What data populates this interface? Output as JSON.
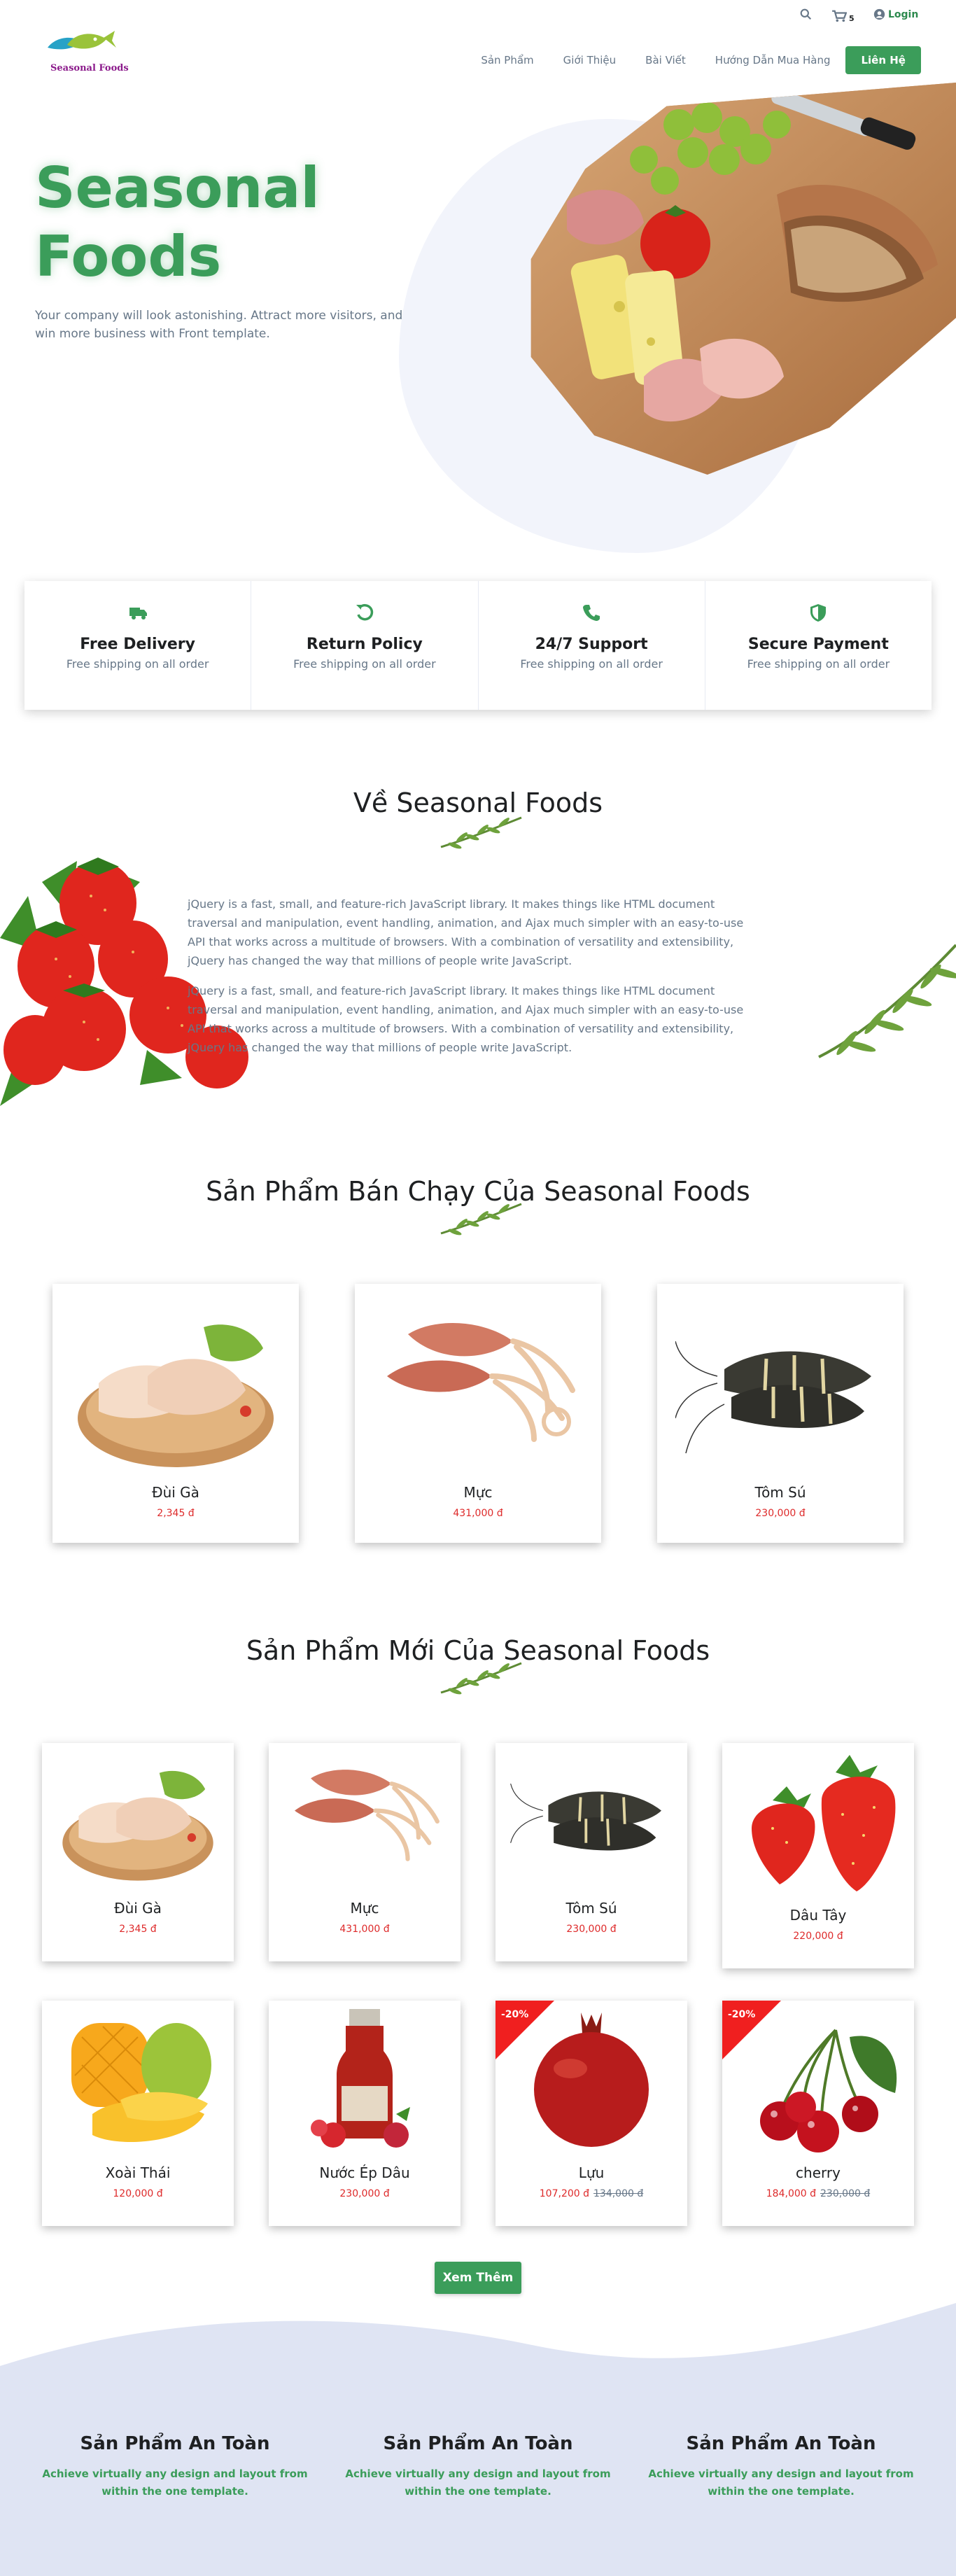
{
  "brand": {
    "name": "Seasonal Foods",
    "accent": "#3b9d5a",
    "logo_color": "#8b1a8b"
  },
  "utility": {
    "search_icon": "search-icon",
    "cart_icon": "cart-icon",
    "cart_count": "5",
    "login_label": "Login"
  },
  "nav": {
    "items": [
      {
        "label": "Sản Phẩm"
      },
      {
        "label": "Giới Thiệu"
      },
      {
        "label": "Bài Viết"
      },
      {
        "label": "Hướng Dẫn Mua Hàng"
      }
    ],
    "contact_label": "Liên Hệ"
  },
  "hero": {
    "title_line1": "Seasonal",
    "title_line2": "Foods",
    "subtitle": "Your company will look astonishing. Attract more visitors, and win more business with Front template."
  },
  "features": [
    {
      "icon": "truck-icon",
      "title": "Free Delivery",
      "desc": "Free shipping on all order"
    },
    {
      "icon": "return-icon",
      "title": "Return Policy",
      "desc": "Free shipping on all order"
    },
    {
      "icon": "phone-icon",
      "title": "24/7 Support",
      "desc": "Free shipping on all order"
    },
    {
      "icon": "shield-icon",
      "title": "Secure Payment",
      "desc": "Free shipping on all order"
    }
  ],
  "about": {
    "title": "Về Seasonal Foods",
    "paragraph1": "jQuery is a fast, small, and feature-rich JavaScript library. It makes things like HTML document traversal and manipulation, event handling, animation, and Ajax much simpler with an easy-to-use API that works across a multitude of browsers. With a combination of versatility and extensibility, jQuery has changed the way that millions of people write JavaScript.",
    "paragraph2": "jQuery is a fast, small, and feature-rich JavaScript library. It makes things like HTML document traversal and manipulation, event handling, animation, and Ajax much simpler with an easy-to-use API that works across a multitude of browsers. With a combination of versatility and extensibility, jQuery has changed the way that millions of people write JavaScript."
  },
  "bestsellers": {
    "title": "Sản Phẩm Bán Chạy Của Seasonal Foods",
    "items": [
      {
        "name": "Đùi Gà",
        "price": "2,345 đ"
      },
      {
        "name": "Mực",
        "price": "431,000 đ"
      },
      {
        "name": "Tôm Sú",
        "price": "230,000 đ"
      }
    ]
  },
  "new_products": {
    "title": "Sản Phẩm Mới Của Seasonal Foods",
    "items": [
      {
        "name": "Đùi Gà",
        "price": "2,345 đ"
      },
      {
        "name": "Mực",
        "price": "431,000 đ"
      },
      {
        "name": "Tôm Sú",
        "price": "230,000 đ"
      },
      {
        "name": "Dâu Tây",
        "price": "220,000 đ"
      },
      {
        "name": "Xoài Thái",
        "price": "120,000 đ"
      },
      {
        "name": "Nước Ép Dâu",
        "price": "230,000 đ"
      },
      {
        "name": "Lựu",
        "price": "107,200 đ",
        "old_price": "134,000 đ",
        "badge": "-20%"
      },
      {
        "name": "cherry",
        "price": "184,000 đ",
        "old_price": "230,000 đ",
        "badge": "-20%"
      }
    ],
    "more_label": "Xem Thêm"
  },
  "safety": [
    {
      "title": "Sản Phẩm An Toàn",
      "desc": "Achieve virtually any design and layout from within the one template."
    },
    {
      "title": "Sản Phẩm An Toàn",
      "desc": "Achieve virtually any design and layout from within the one template."
    },
    {
      "title": "Sản Phẩm An Toàn",
      "desc": "Achieve virtually any design and layout from within the one template."
    }
  ]
}
